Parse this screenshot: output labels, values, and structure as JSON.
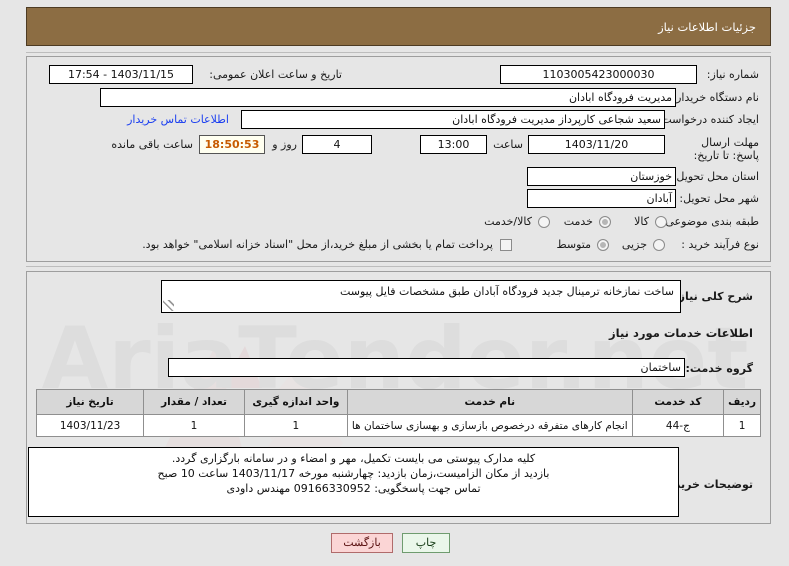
{
  "header": {
    "title": "جزئیات اطلاعات نیاز"
  },
  "colors": {
    "header_bg": "#8c6d43",
    "link": "#1b3ff0",
    "countdown_text": "#c75b00",
    "print_btn": "#eaf7ea",
    "back_btn": "#fbd5d5"
  },
  "watermark": {
    "text": "AriaTender.net"
  },
  "top_section": {
    "need_number_label": "شماره نیاز:",
    "need_number_value": "1103005423000030",
    "public_announce_label": "تاریخ و ساعت اعلان عمومی:",
    "public_announce_value": "1403/11/15 - 17:54",
    "buyer_org_label": "نام دستگاه خریدار:",
    "buyer_org_value": "مدیریت فرودگاه ابادان",
    "creator_label": "ایجاد کننده درخواست:",
    "creator_value": "سعید شجاعی کارپرداز مدیریت فرودگاه ابادان",
    "contact_link": "اطلاعات تماس خریدار",
    "deadline_label": "مهلت ارسال پاسخ: تا تاریخ:",
    "deadline_date": "1403/11/20",
    "hour_label": "ساعت",
    "deadline_time": "13:00",
    "days_value": "4",
    "days_label": "روز و",
    "countdown_value": "18:50:53",
    "remaining_label": "ساعت باقی مانده",
    "province_label": "استان محل تحویل:",
    "province_value": "خوزستان",
    "city_label": "شهر محل تحویل:",
    "city_value": "آبادان",
    "category_label": "طبقه بندی موضوعی:",
    "category_options": [
      {
        "label": "کالا",
        "selected": false
      },
      {
        "label": "خدمت",
        "selected": true
      },
      {
        "label": "کالا/خدمت",
        "selected": false
      }
    ],
    "process_label": "نوع فرآیند خرید :",
    "process_options": [
      {
        "label": "جزیی",
        "selected": false
      },
      {
        "label": "متوسط",
        "selected": true
      }
    ],
    "treasury_checkbox_label": "پرداخت تمام یا بخشی از مبلغ خرید،از محل \"اسناد خزانه اسلامی\" خواهد بود.",
    "treasury_checked": false
  },
  "main_section": {
    "summary_label": "شرح کلی نیاز:",
    "summary_value": "ساخت نمازخانه ترمینال جدید فرودگاه آبادان طبق مشخصات فایل پیوست",
    "services_heading": "اطلاعات خدمات مورد نیاز",
    "service_group_label": "گروه خدمت:",
    "service_group_value": "ساختمان",
    "table": {
      "headers": [
        "ردیف",
        "کد خدمت",
        "نام خدمت",
        "واحد اندازه گیری",
        "تعداد / مقدار",
        "تاریخ نیاز"
      ],
      "rows": [
        {
          "row": "1",
          "code": "ج-44",
          "name": "انجام کارهای متفرقه درخصوص بازسازی و بهسازی ساختمان ها",
          "unit": "1",
          "qty": "1",
          "need_date": "1403/11/23"
        }
      ]
    },
    "notes_label": "توضیحات خریدار:",
    "notes_lines": [
      "کلیه مدارک پیوستی می بایست تکمیل، مهر و امضاء و در سامانه بارگزاری گردد.",
      "بازدید از مکان الزامیست،زمان بازدید: چهارشنبه مورخه 1403/11/17 ساعت 10 صبح",
      "تماس جهت پاسخگویی: 09166330952 مهندس داودی"
    ]
  },
  "footer": {
    "print_label": "چاپ",
    "back_label": "بازگشت"
  }
}
